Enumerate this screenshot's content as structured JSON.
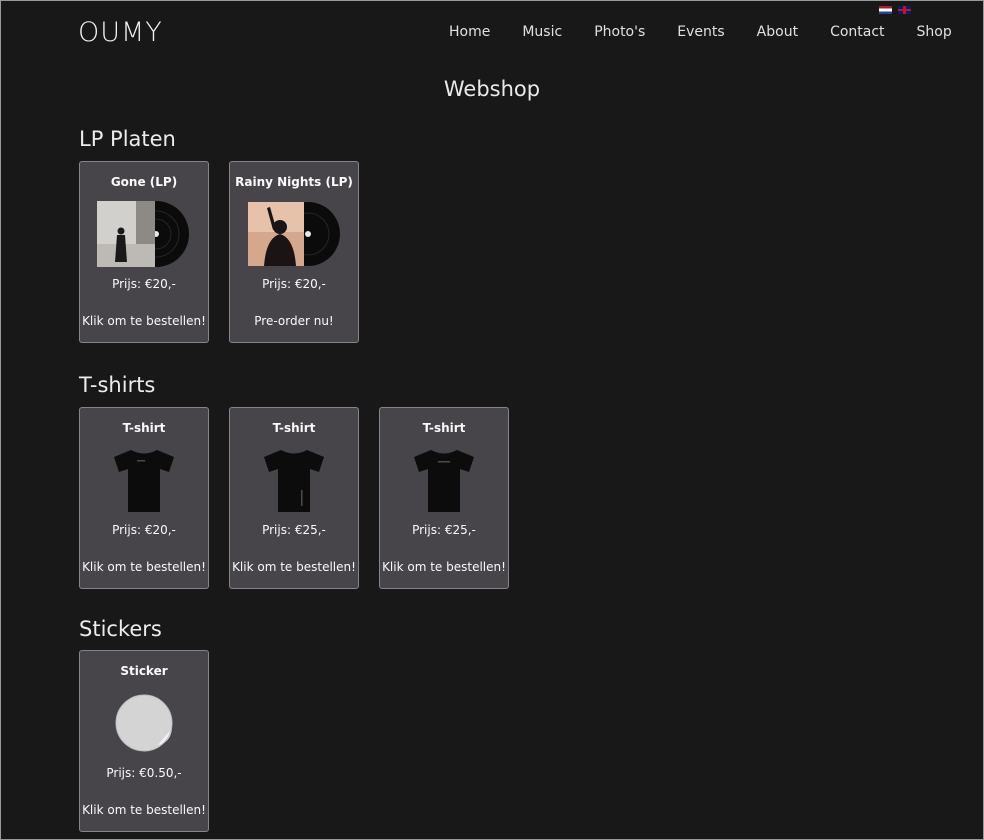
{
  "brand": {
    "logo": "OUMY"
  },
  "languages": [
    {
      "name": "flag-nl-icon"
    },
    {
      "name": "flag-uk-icon"
    }
  ],
  "nav": {
    "items": [
      {
        "label": "Home"
      },
      {
        "label": "Music"
      },
      {
        "label": "Photo's"
      },
      {
        "label": "Events"
      },
      {
        "label": "About"
      },
      {
        "label": "Contact"
      },
      {
        "label": "Shop"
      }
    ]
  },
  "page": {
    "title": "Webshop"
  },
  "sections": [
    {
      "title": "LP Platen",
      "products": [
        {
          "title": "Gone (LP)",
          "price": "Prijs: €20,-",
          "cta": "Klik om te bestellen!",
          "image": "lp-gone-cover"
        },
        {
          "title": "Rainy Nights (LP)",
          "price": "Prijs: €20,-",
          "cta": "Pre-order nu!",
          "image": "lp-rainy-nights-cover"
        }
      ]
    },
    {
      "title": "T-shirts",
      "products": [
        {
          "title": "T-shirt",
          "price": "Prijs: €20,-",
          "cta": "Klik om te bestellen!",
          "image": "tshirt-black"
        },
        {
          "title": "T-shirt",
          "price": "Prijs: €25,-",
          "cta": "Klik om te bestellen!",
          "image": "tshirt-black"
        },
        {
          "title": "T-shirt",
          "price": "Prijs: €25,-",
          "cta": "Klik om te bestellen!",
          "image": "tshirt-black"
        }
      ]
    },
    {
      "title": "Stickers",
      "products": [
        {
          "title": "Sticker",
          "price": "Prijs: €0.50,-",
          "cta": "Klik om te bestellen!",
          "image": "sticker-round"
        }
      ]
    }
  ],
  "colors": {
    "background": "#181818",
    "card_background": "#47454a",
    "card_border": "#86848a",
    "text": "#e6e6e6"
  }
}
